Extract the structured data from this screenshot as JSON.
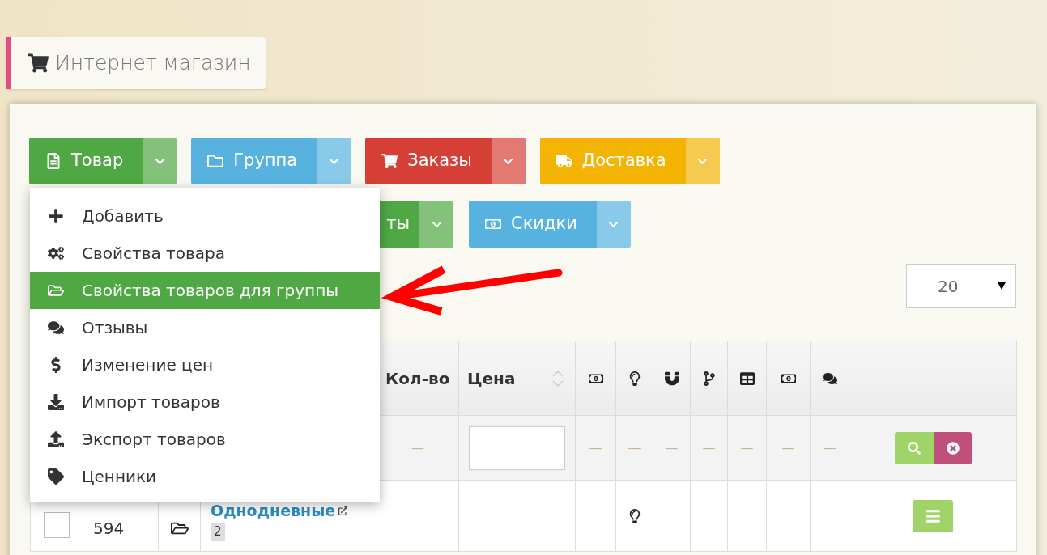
{
  "header": {
    "title": "Интернет магазин"
  },
  "toolbar_rows": [
    [
      {
        "label": "Товар",
        "color": "#4fa843"
      },
      {
        "label": "Группа",
        "color": "#57b2e0"
      },
      {
        "label": "Заказы",
        "color": "#d63f36"
      },
      {
        "label": "Доставка",
        "color": "#f3b404"
      }
    ],
    [
      {
        "label": "ты",
        "color": "#4fa843"
      },
      {
        "label": "Скидки",
        "color": "#57b2e0"
      }
    ]
  ],
  "dropdown_menu": [
    {
      "label": "Добавить",
      "selected": false
    },
    {
      "label": "Свойства товара",
      "selected": false
    },
    {
      "label": "Свойства товаров для группы",
      "selected": true
    },
    {
      "label": "Отзывы",
      "selected": false
    },
    {
      "label": "Изменение цен",
      "selected": false
    },
    {
      "label": "Импорт товаров",
      "selected": false
    },
    {
      "label": "Экспорт товаров",
      "selected": false
    },
    {
      "label": "Ценники",
      "selected": false
    }
  ],
  "page_size": {
    "value": "20"
  },
  "table": {
    "columns": [
      {
        "kind": "blank"
      },
      {
        "kind": "blank"
      },
      {
        "kind": "blank"
      },
      {
        "kind": "blank"
      },
      {
        "kind": "text",
        "label": "Кол-во",
        "sortable": false
      },
      {
        "kind": "text",
        "label": "Цена",
        "sortable": true
      },
      {
        "kind": "icon"
      },
      {
        "kind": "icon"
      },
      {
        "kind": "icon"
      },
      {
        "kind": "icon"
      },
      {
        "kind": "icon"
      },
      {
        "kind": "icon"
      },
      {
        "kind": "icon"
      },
      {
        "kind": "blank"
      }
    ],
    "filter_row": [
      {
        "kind": "blank"
      },
      {
        "kind": "blank"
      },
      {
        "kind": "blank"
      },
      {
        "kind": "blank"
      },
      {
        "kind": "dash",
        "text": "—"
      },
      {
        "kind": "input"
      },
      {
        "kind": "dash",
        "text": "—"
      },
      {
        "kind": "dash",
        "text": "—"
      },
      {
        "kind": "dash",
        "text": "—"
      },
      {
        "kind": "dash",
        "text": "—"
      },
      {
        "kind": "dash",
        "text": "—"
      },
      {
        "kind": "dash",
        "text": "—"
      },
      {
        "kind": "dash",
        "text": "—"
      },
      {
        "kind": "actions"
      }
    ],
    "rows": [
      {
        "checked": false,
        "code": "594",
        "name": "Однодневные",
        "badge": "2",
        "flags": [
          false,
          true,
          false,
          false,
          false,
          false,
          false
        ]
      }
    ]
  }
}
